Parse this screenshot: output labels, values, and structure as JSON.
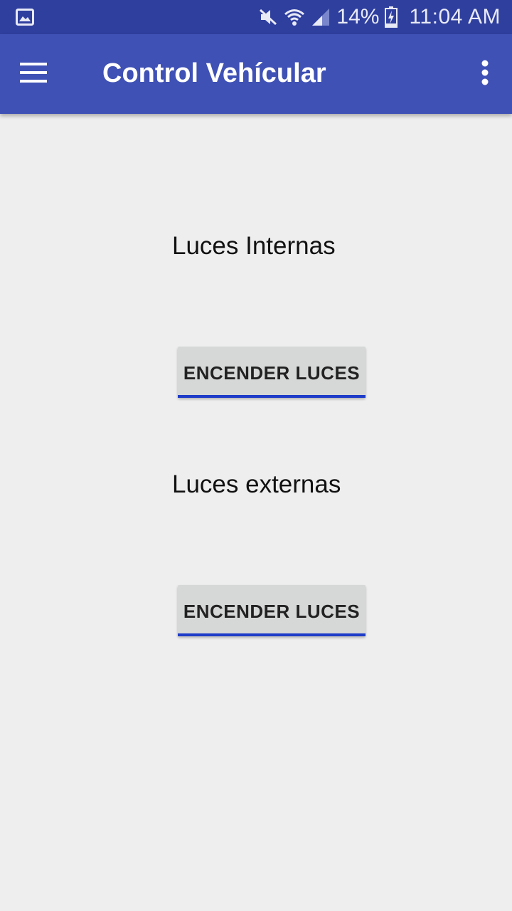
{
  "status_bar": {
    "battery_percent": "14%",
    "time": "11:04 AM",
    "icons": [
      "image-notification-icon",
      "mute-icon",
      "wifi-icon",
      "signal-icon",
      "battery-charging-icon"
    ]
  },
  "app_bar": {
    "title": "Control Vehícular",
    "background_color": "#3f51b5",
    "status_bar_color": "#2f3f9e"
  },
  "main": {
    "sections": [
      {
        "label": "Luces Internas",
        "button_label": "ENCENDER LUCES"
      },
      {
        "label": "Luces externas",
        "button_label": "ENCENDER LUCES"
      }
    ],
    "button_accent_color": "#1e3cc8"
  }
}
